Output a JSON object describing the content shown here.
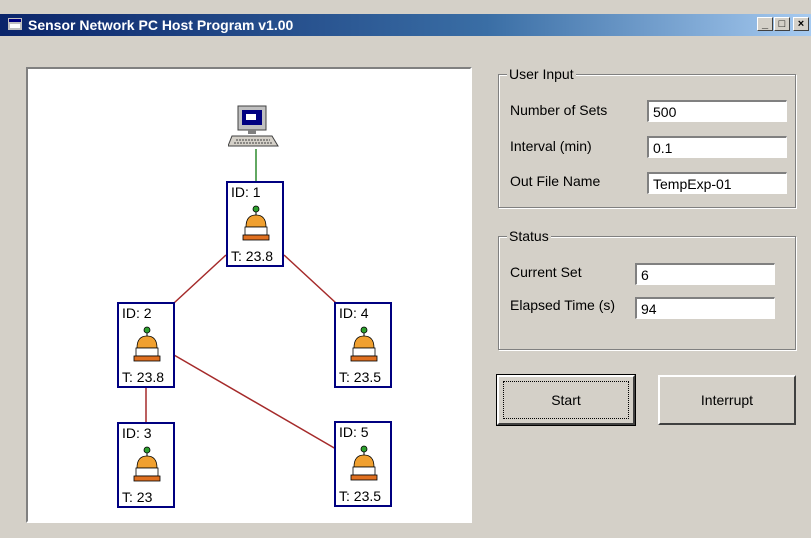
{
  "window": {
    "title": "Sensor Network PC Host Program v1.00",
    "buttons": {
      "minimize": "_",
      "maximize": "□",
      "close": "×"
    }
  },
  "network": {
    "host_icon": "computer-icon",
    "nodes": [
      {
        "id_label": "ID: 1",
        "temp_label": "T: 23.8"
      },
      {
        "id_label": "ID: 2",
        "temp_label": "T: 23.8"
      },
      {
        "id_label": "ID: 3",
        "temp_label": "T: 23"
      },
      {
        "id_label": "ID: 4",
        "temp_label": "T: 23.5"
      },
      {
        "id_label": "ID: 5",
        "temp_label": "T: 23.5"
      }
    ],
    "links": [
      [
        "host",
        "1"
      ],
      [
        "1",
        "2"
      ],
      [
        "1",
        "4"
      ],
      [
        "2",
        "3"
      ],
      [
        "2",
        "5"
      ]
    ],
    "colors": {
      "host_link": "#2e8b2e",
      "node_link": "#a52a2a",
      "node_border": "#000080"
    }
  },
  "user_input": {
    "title": "User Input",
    "number_of_sets_label": "Number of Sets",
    "number_of_sets_value": "500",
    "interval_label": "Interval (min)",
    "interval_value": "0.1",
    "out_file_label": "Out File Name",
    "out_file_value": "TempExp-01"
  },
  "status": {
    "title": "Status",
    "current_set_label": "Current Set",
    "current_set_value": "6",
    "elapsed_label": "Elapsed Time (s)",
    "elapsed_value": "94"
  },
  "actions": {
    "start_label": "Start",
    "interrupt_label": "Interrupt"
  }
}
